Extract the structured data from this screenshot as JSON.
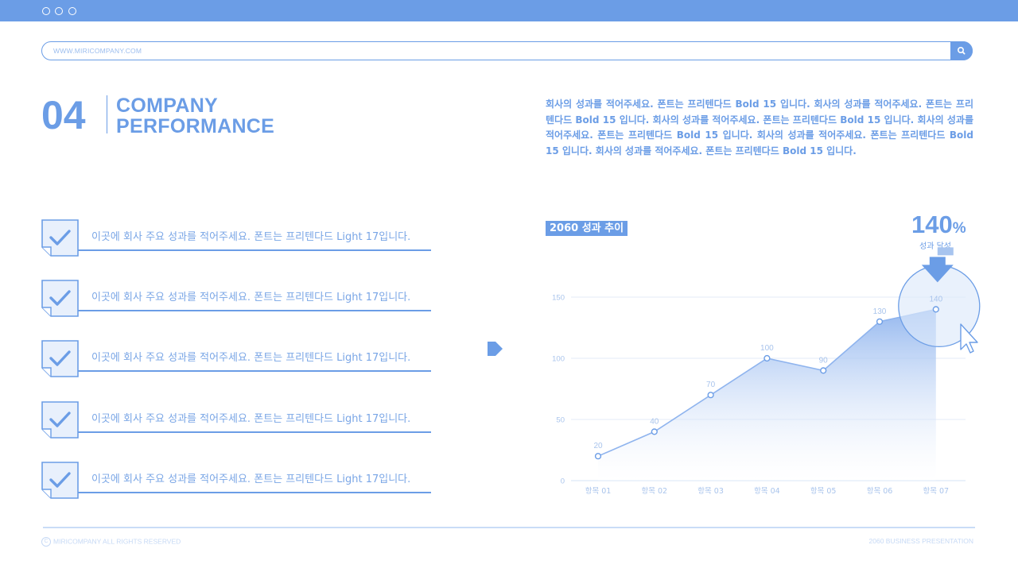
{
  "window": {
    "url": "WWW.MIRICOMPANY.COM"
  },
  "header": {
    "number": "04",
    "title_line1": "COMPANY",
    "title_line2": "PERFORMANCE",
    "description": "회사의 성과를 적어주세요. 폰트는 프리텐다드 Bold 15 입니다. 회사의 성과를 적어주세요. 폰트는 프리텐다드 Bold 15 입니다. 회사의 성과를 적어주세요. 폰트는 프리텐다드 Bold 15 입니다. 회사의 성과를 적어주세요. 폰트는 프리텐다드 Bold 15 입니다. 회사의 성과를 적어주세요. 폰트는 프리텐다드 Bold 15 입니다. 회사의 성과를 적어주세요. 폰트는 프리텐다드 Bold 15 입니다."
  },
  "checklist": [
    "이곳에 회사 주요 성과를 적어주세요. 폰트는 프리텐다드 Light 17입니다.",
    "이곳에 회사 주요 성과를 적어주세요. 폰트는 프리텐다드 Light 17입니다.",
    "이곳에 회사 주요 성과를 적어주세요. 폰트는 프리텐다드 Light 17입니다.",
    "이곳에 회사 주요 성과를 적어주세요. 폰트는 프리텐다드 Light 17입니다.",
    "이곳에 회사 주요 성과를 적어주세요. 폰트는 프리텐다드 Light 17입니다."
  ],
  "chart_label": "2060 성과 추이",
  "highlight": {
    "value": "140",
    "unit": "%",
    "caption": "성과 달성"
  },
  "chart_data": {
    "type": "area",
    "categories": [
      "항목 01",
      "항목 02",
      "항목 03",
      "항목 04",
      "항목 05",
      "항목 06",
      "항목 07"
    ],
    "values": [
      20,
      40,
      70,
      100,
      90,
      130,
      140
    ],
    "ylim": [
      0,
      150
    ],
    "yticks": [
      0,
      50,
      100,
      150
    ],
    "grid": true,
    "highlight_index": 6
  },
  "colors": {
    "accent": "#6b9de6",
    "light": "#c9dcf7"
  },
  "footer": {
    "left": "MIRICOMPANY ALL RIGHTS RESERVED",
    "copyright_symbol": "C",
    "right": "2060 BUSINESS PRESENTATION"
  }
}
